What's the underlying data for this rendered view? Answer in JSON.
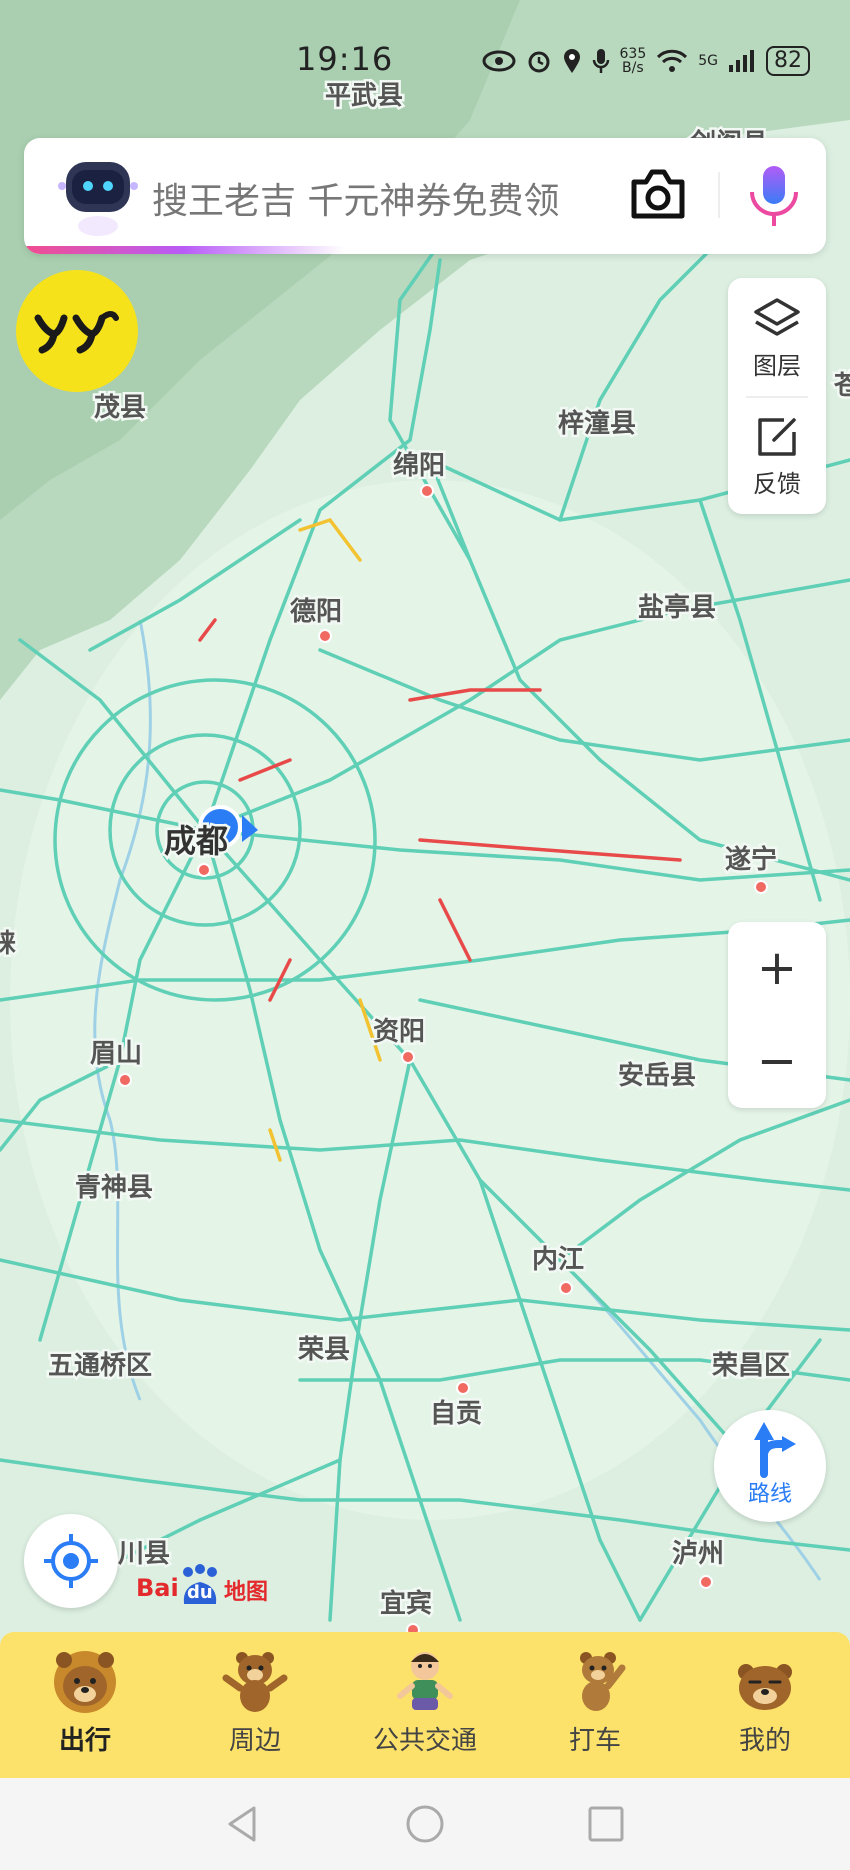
{
  "status_bar": {
    "time": "19:16",
    "net_speed_value": "635",
    "net_speed_unit": "B/s",
    "network": "5G",
    "battery": "82",
    "icons": [
      "eye-icon",
      "alarm-icon",
      "location-icon",
      "mic-icon",
      "wifi-icon",
      "signal-icon",
      "battery-icon"
    ]
  },
  "search": {
    "placeholder": "搜王老吉 千元神券免费领",
    "camera_icon": "camera-icon",
    "mic_icon": "mic-icon"
  },
  "yy_badge": {
    "text": "yy",
    "color": "#f6e21a"
  },
  "right_panel": {
    "layers_label": "图层",
    "feedback_label": "反馈"
  },
  "zoom": {
    "in": "+",
    "out": "−"
  },
  "route_button": {
    "label": "路线"
  },
  "baidu_logo": {
    "text_left": "Bai",
    "text_mid": "du",
    "text_right": "地图"
  },
  "map": {
    "labels": [
      {
        "id": "pingwu",
        "text": "平武县"
      },
      {
        "id": "maoxian",
        "text": "茂县"
      },
      {
        "id": "zitong",
        "text": "梓潼县"
      },
      {
        "id": "mianyang",
        "text": "绵阳"
      },
      {
        "id": "deyang",
        "text": "德阳"
      },
      {
        "id": "yanting",
        "text": "盐亭县"
      },
      {
        "id": "chengdu",
        "text": "成都"
      },
      {
        "id": "suining",
        "text": "遂宁"
      },
      {
        "id": "meishan",
        "text": "眉山"
      },
      {
        "id": "ziyang",
        "text": "资阳"
      },
      {
        "id": "anyue",
        "text": "安岳县"
      },
      {
        "id": "qingshen",
        "text": "青神县"
      },
      {
        "id": "neijiang",
        "text": "内江"
      },
      {
        "id": "wutongqiao",
        "text": "五通桥区"
      },
      {
        "id": "rongxian",
        "text": "荣县"
      },
      {
        "id": "zigong",
        "text": "自贡"
      },
      {
        "id": "rongchang",
        "text": "荣昌区"
      },
      {
        "id": "xxchuan",
        "text": "川县"
      },
      {
        "id": "luzhou",
        "text": "泸州"
      },
      {
        "id": "yibin",
        "text": "宜宾"
      },
      {
        "id": "jiange",
        "text": "剑阁县"
      },
      {
        "id": "edge_right",
        "text": "苍"
      },
      {
        "id": "edge_left",
        "text": "崃"
      }
    ]
  },
  "bottom_nav": {
    "items": [
      {
        "label": "出行",
        "active": true,
        "icon": "bear-travel-icon"
      },
      {
        "label": "周边",
        "active": false,
        "icon": "bear-nearby-icon"
      },
      {
        "label": "公共交通",
        "active": false,
        "icon": "boy-transit-icon"
      },
      {
        "label": "打车",
        "active": false,
        "icon": "bear-taxi-icon"
      },
      {
        "label": "我的",
        "active": false,
        "icon": "bear-profile-icon"
      }
    ]
  },
  "system_nav": {
    "icons": [
      "back-icon",
      "home-icon",
      "recents-icon"
    ]
  },
  "colors": {
    "road": "#5fcfb6",
    "congestion_red": "#e84a4a",
    "congestion_yellow": "#f2c230",
    "nav_bg": "#fce26a",
    "accent_blue": "#2a7df4"
  }
}
